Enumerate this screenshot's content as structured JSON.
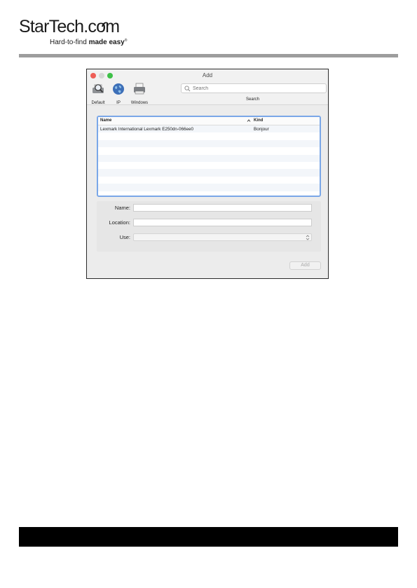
{
  "logo": {
    "wordmark_main": "StarTech",
    "wordmark_com": ".com",
    "tagline_light": "Hard-to-find",
    "tagline_bold": "made easy",
    "tagline_mark": "®"
  },
  "window": {
    "title": "Add",
    "toolbar": [
      {
        "label": "Default",
        "icon": "printer-search-icon"
      },
      {
        "label": "IP",
        "icon": "globe-icon"
      },
      {
        "label": "Windows",
        "icon": "windows-printer-icon"
      }
    ],
    "search": {
      "placeholder": "Search",
      "label": "Search"
    },
    "list": {
      "columns": {
        "name": "Name",
        "kind": "Kind"
      },
      "rows": [
        {
          "name": "Lexmark International Lexmark E250dn-066ee0",
          "kind": "Bonjour"
        }
      ]
    },
    "form": {
      "name_label": "Name:",
      "location_label": "Location:",
      "use_label": "Use:",
      "name_value": "",
      "location_value": "",
      "use_value": ""
    },
    "add_button": "Add"
  },
  "colors": {
    "header_rule": "#9d9d9d",
    "list_focus_border": "#7aa7e8",
    "footer_bar": "#000000"
  }
}
